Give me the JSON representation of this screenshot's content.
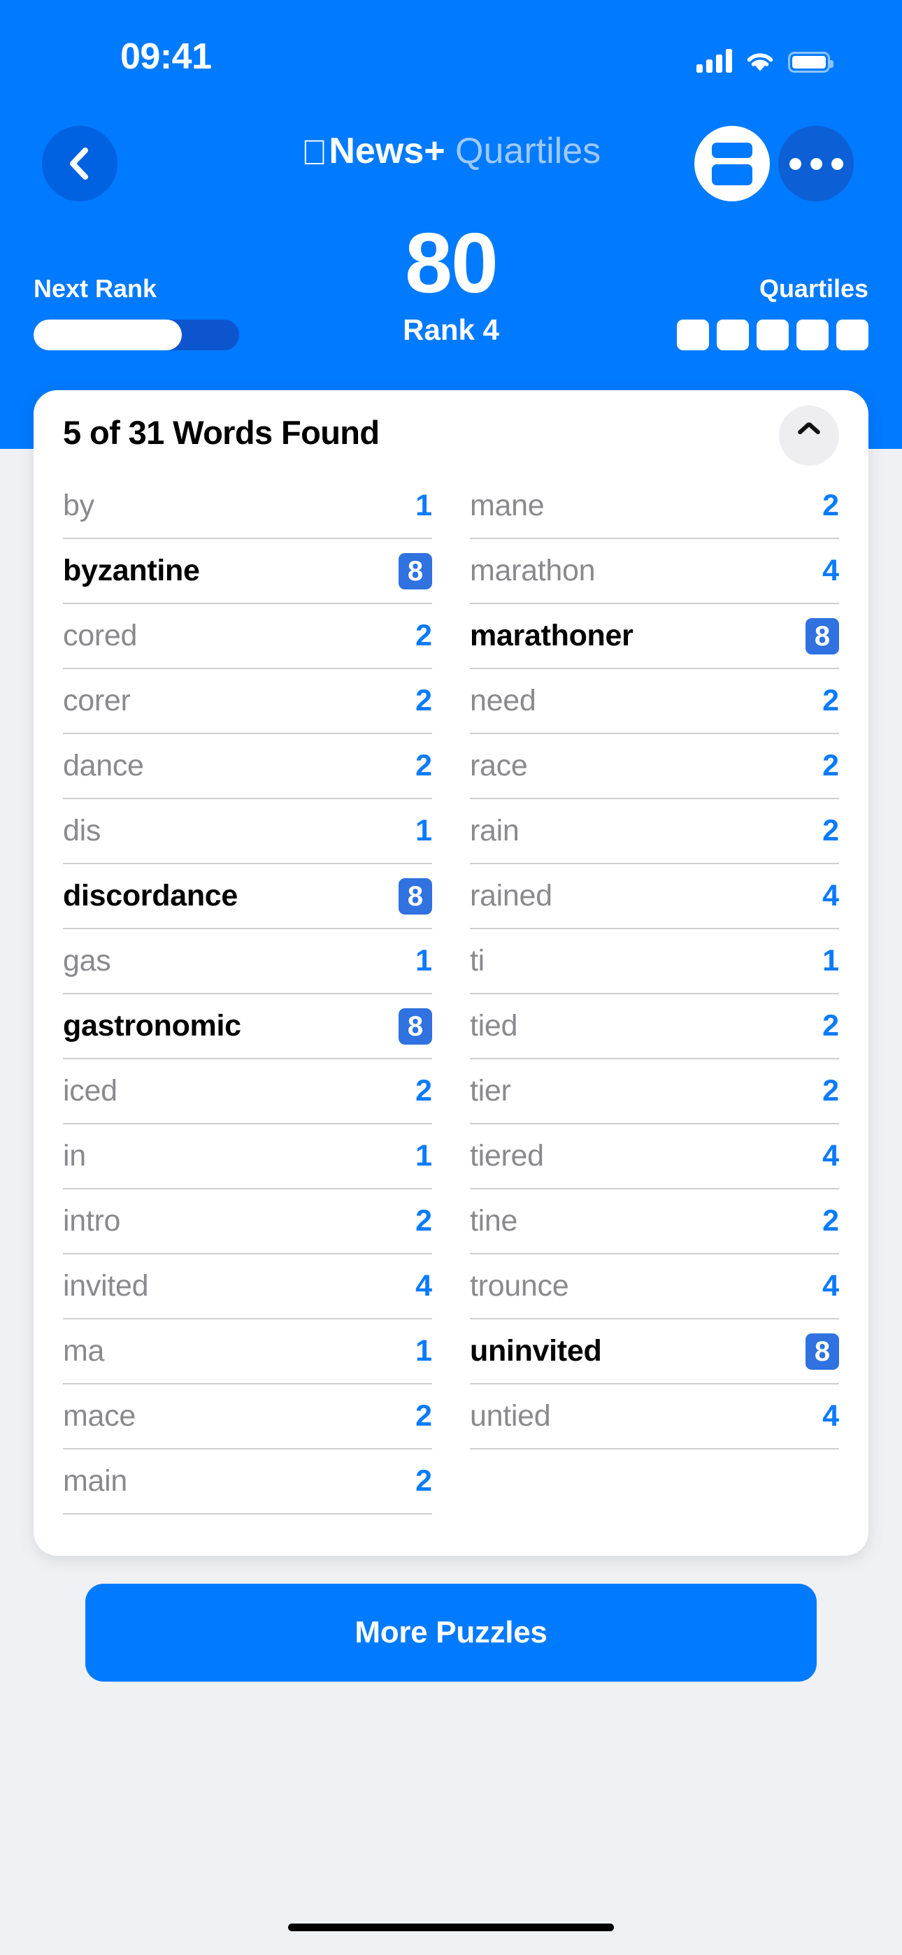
{
  "status_bar": {
    "time": "09:41",
    "signal_icon": "cellular-signal-icon",
    "wifi_icon": "wifi-icon",
    "battery_icon": "battery-icon"
  },
  "nav": {
    "back_icon": "chevron-left-icon",
    "brand_apple_glyph": "",
    "brand_primary": "News+",
    "brand_secondary": "Quartiles",
    "word_list_icon": "word-list-icon",
    "more_icon": "ellipsis-icon"
  },
  "score_panel": {
    "score": "80",
    "rank_label": "Rank 4",
    "next_rank_label": "Next Rank",
    "next_rank_progress_percent": 72,
    "quartiles_label": "Quartiles",
    "quartile_count": 5
  },
  "words_card": {
    "title": "5 of 31 Words Found",
    "found_count": 5,
    "total_count": 31,
    "collapse_icon": "chevron-up-icon",
    "columns": [
      {
        "rows": [
          {
            "word": "by",
            "points": "1",
            "found": false
          },
          {
            "word": "byzantine",
            "points": "8",
            "found": true
          },
          {
            "word": "cored",
            "points": "2",
            "found": false
          },
          {
            "word": "corer",
            "points": "2",
            "found": false
          },
          {
            "word": "dance",
            "points": "2",
            "found": false
          },
          {
            "word": "dis",
            "points": "1",
            "found": false
          },
          {
            "word": "discordance",
            "points": "8",
            "found": true
          },
          {
            "word": "gas",
            "points": "1",
            "found": false
          },
          {
            "word": "gastronomic",
            "points": "8",
            "found": true
          },
          {
            "word": "iced",
            "points": "2",
            "found": false
          },
          {
            "word": "in",
            "points": "1",
            "found": false
          },
          {
            "word": "intro",
            "points": "2",
            "found": false
          },
          {
            "word": "invited",
            "points": "4",
            "found": false
          },
          {
            "word": "ma",
            "points": "1",
            "found": false
          },
          {
            "word": "mace",
            "points": "2",
            "found": false
          },
          {
            "word": "main",
            "points": "2",
            "found": false
          }
        ]
      },
      {
        "rows": [
          {
            "word": "mane",
            "points": "2",
            "found": false
          },
          {
            "word": "marathon",
            "points": "4",
            "found": false
          },
          {
            "word": "marathoner",
            "points": "8",
            "found": true
          },
          {
            "word": "need",
            "points": "2",
            "found": false
          },
          {
            "word": "race",
            "points": "2",
            "found": false
          },
          {
            "word": "rain",
            "points": "2",
            "found": false
          },
          {
            "word": "rained",
            "points": "4",
            "found": false
          },
          {
            "word": "ti",
            "points": "1",
            "found": false
          },
          {
            "word": "tied",
            "points": "2",
            "found": false
          },
          {
            "word": "tier",
            "points": "2",
            "found": false
          },
          {
            "word": "tiered",
            "points": "4",
            "found": false
          },
          {
            "word": "tine",
            "points": "2",
            "found": false
          },
          {
            "word": "trounce",
            "points": "4",
            "found": false
          },
          {
            "word": "uninvited",
            "points": "8",
            "found": true
          },
          {
            "word": "untied",
            "points": "4",
            "found": false
          }
        ]
      }
    ]
  },
  "footer": {
    "more_puzzles_label": "More Puzzles"
  },
  "colors": {
    "accent_blue": "#007aff",
    "header_blue": "#007aff",
    "dark_blue": "#0d5fd6",
    "badge_blue": "#2f72e0",
    "score_blue": "#0a7bff",
    "muted_text": "#8a8a8e",
    "page_bg": "#f0f1f5"
  }
}
